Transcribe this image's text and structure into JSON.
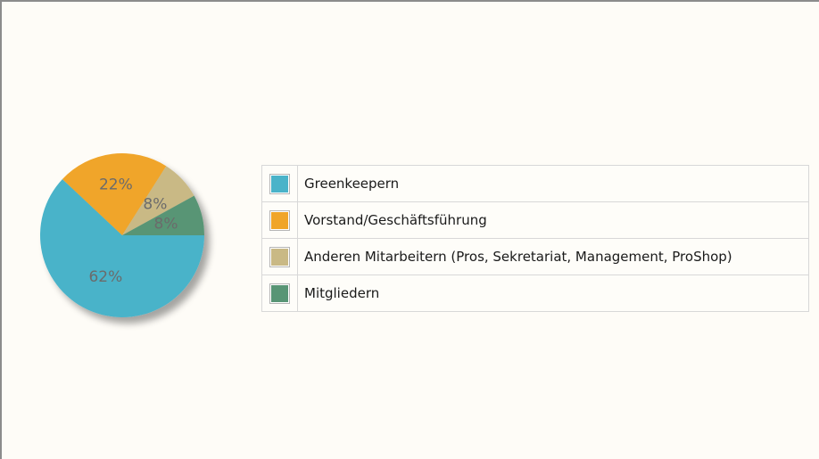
{
  "chart_data": {
    "type": "pie",
    "title": "",
    "legend_position": "right",
    "slices": [
      {
        "name": "Greenkeepern",
        "value": 62,
        "label": "62%",
        "color": "#4ab3c9"
      },
      {
        "name": "Vorstand/Geschäftsführung",
        "value": 22,
        "label": "22%",
        "color": "#f0a529"
      },
      {
        "name": "Anderen Mitarbeitern (Pros, Sekretariat, Management, ProShop)",
        "value": 8,
        "label": "8%",
        "color": "#c9b985"
      },
      {
        "name": "Mitgliedern",
        "value": 8,
        "label": "8%",
        "color": "#589575"
      }
    ]
  },
  "legend": {
    "items": [
      {
        "label": "Greenkeepern",
        "color": "#4ab3c9"
      },
      {
        "label": "Vorstand/Geschäftsführung",
        "color": "#f0a529"
      },
      {
        "label": "Anderen Mitarbeitern (Pros, Sekretariat, Management, ProShop)",
        "color": "#c9b985"
      },
      {
        "label": "Mitgliedern",
        "color": "#589575"
      }
    ]
  }
}
